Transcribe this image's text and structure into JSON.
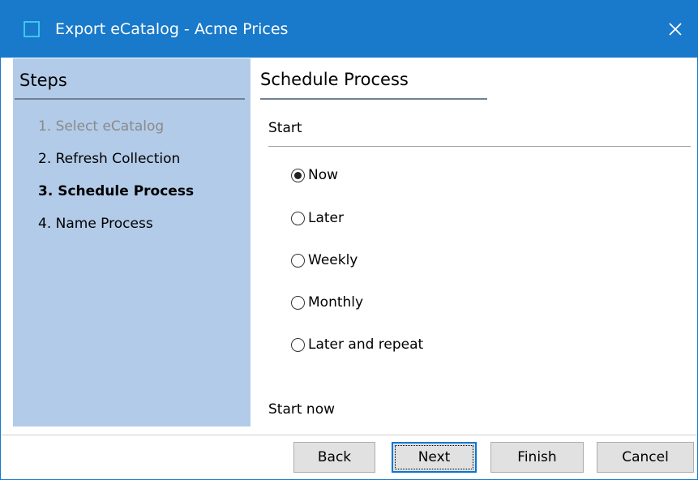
{
  "window": {
    "title": "Export eCatalog - Acme Prices",
    "accent": "#1979ca",
    "close_icon": "close-icon"
  },
  "steps": {
    "title": "Steps",
    "items": [
      {
        "label": "1. Select eCatalog",
        "state": "disabled"
      },
      {
        "label": "2. Refresh Collection",
        "state": "normal"
      },
      {
        "label": "3. Schedule Process",
        "state": "current"
      },
      {
        "label": "4. Name Process",
        "state": "normal"
      }
    ]
  },
  "content": {
    "title": "Schedule Process",
    "section_label": "Start",
    "options": [
      {
        "label": "Now",
        "selected": true
      },
      {
        "label": "Later",
        "selected": false
      },
      {
        "label": "Weekly",
        "selected": false
      },
      {
        "label": "Monthly",
        "selected": false
      },
      {
        "label": "Later and repeat",
        "selected": false
      }
    ],
    "status": "Start now"
  },
  "buttons": {
    "back": "Back",
    "next": "Next",
    "finish": "Finish",
    "cancel": "Cancel"
  }
}
